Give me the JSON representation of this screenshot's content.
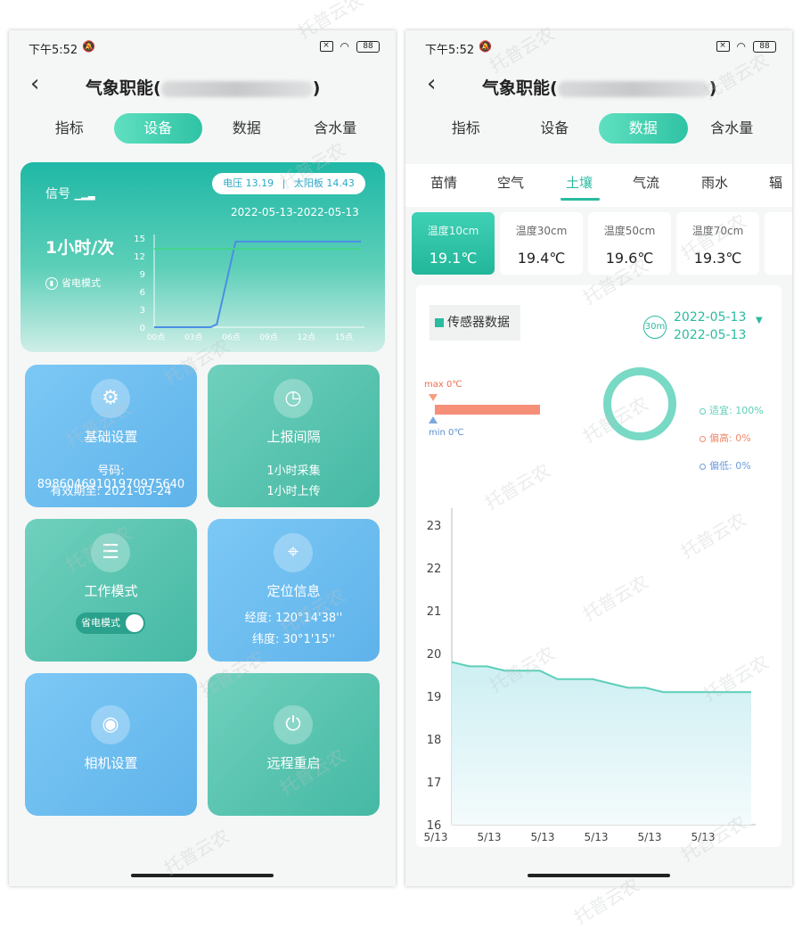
{
  "status": {
    "time": "下午5:52",
    "battery": "88"
  },
  "left": {
    "title_prefix": "气象职能(",
    "title_suffix": ")",
    "tabs": [
      {
        "label": "指标"
      },
      {
        "label": "设备"
      },
      {
        "label": "数据"
      },
      {
        "label": "含水量"
      }
    ],
    "hero": {
      "signal_label": "信号",
      "voltage_text": "电压 13.19",
      "solar_text": "太阳板 14.43",
      "date_range": "2022-05-13-2022-05-13",
      "frequency": "1小时/次",
      "power_save": "省电模式"
    },
    "cards": {
      "basic": {
        "label": "基础设置",
        "line1": "号码: 89860469101970975640",
        "line2": "有效期至: 2021-03-24"
      },
      "report": {
        "label": "上报间隔",
        "line1": "1小时采集",
        "line2": "1小时上传"
      },
      "work": {
        "label": "工作模式",
        "toggle_label": "省电模式"
      },
      "location": {
        "label": "定位信息",
        "line1": "经度: 120°14'38''",
        "line2": "纬度: 30°1'15''"
      },
      "camera": {
        "label": "相机设置"
      },
      "reboot": {
        "label": "远程重启"
      }
    }
  },
  "right": {
    "title_prefix": "气象职能(",
    "title_suffix": ")",
    "tabs": [
      {
        "label": "指标"
      },
      {
        "label": "设备"
      },
      {
        "label": "数据"
      },
      {
        "label": "含水量"
      }
    ],
    "subtabs": [
      {
        "label": "苗情"
      },
      {
        "label": "空气"
      },
      {
        "label": "土壤"
      },
      {
        "label": "气流"
      },
      {
        "label": "雨水"
      },
      {
        "label": "辐"
      }
    ],
    "depths": [
      {
        "label": "温度10cm",
        "value": "19.1℃"
      },
      {
        "label": "温度30cm",
        "value": "19.4℃"
      },
      {
        "label": "温度50cm",
        "value": "19.6℃"
      },
      {
        "label": "温度70cm",
        "value": "19.3℃"
      }
    ],
    "sensor_label": "传感器数据",
    "interval_badge": "30m",
    "date_start": "2022-05-13",
    "date_end": "2022-05-13",
    "max_label": "max 0℃",
    "min_label": "min 0℃",
    "legend": [
      {
        "label": "适宜: 100%",
        "color": "#5ccfb8"
      },
      {
        "label": "偏高: 0%",
        "color": "#f08a6c"
      },
      {
        "label": "偏低: 0%",
        "color": "#6d9edb"
      }
    ]
  },
  "watermark": "托普云农",
  "chart_data": [
    {
      "type": "line",
      "x_labels": [
        "00点",
        "03点",
        "06点",
        "09点",
        "12点",
        "15点"
      ],
      "y_ticks": [
        0,
        3,
        6,
        9,
        12,
        15
      ],
      "ylim": [
        0,
        15
      ],
      "series": [
        {
          "color": "#4a8fe3",
          "x": [
            0,
            4.5,
            5.0,
            6.5,
            16.5
          ],
          "values": [
            0,
            0,
            0.5,
            14.4,
            14.4
          ]
        },
        {
          "color": "#46d28c",
          "x": [
            0,
            16.5
          ],
          "values": [
            13.2,
            13.2
          ]
        }
      ]
    },
    {
      "type": "area",
      "y_ticks": [
        16,
        17,
        18,
        19,
        20,
        21,
        22,
        23
      ],
      "ylim": [
        16,
        23.5
      ],
      "x_labels": [
        "5/13",
        "5/13",
        "5/13",
        "5/13",
        "5/13",
        "5/13"
      ],
      "series": [
        {
          "color": "#5ccfb8",
          "values": [
            19.8,
            19.7,
            19.7,
            19.6,
            19.6,
            19.6,
            19.4,
            19.4,
            19.4,
            19.3,
            19.2,
            19.2,
            19.1,
            19.1,
            19.1,
            19.1,
            19.1,
            19.1
          ]
        }
      ]
    }
  ]
}
